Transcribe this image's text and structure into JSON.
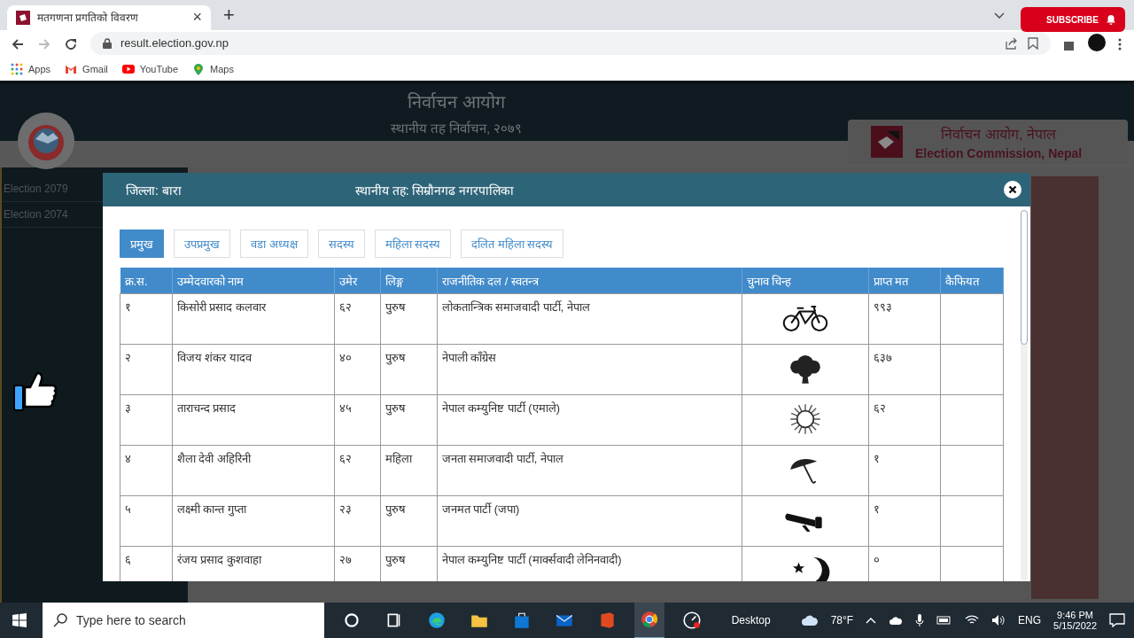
{
  "browser": {
    "tab_title": "मतगणना प्रगतिको विवरण",
    "tab_close": "×",
    "new_tab": "+",
    "url": "result.election.gov.np",
    "bookmarks": [
      {
        "label": "Apps",
        "kind": "apps"
      },
      {
        "label": "Gmail",
        "kind": "gmail"
      },
      {
        "label": "YouTube",
        "kind": "youtube"
      },
      {
        "label": "Maps",
        "kind": "maps"
      }
    ]
  },
  "subscribe": {
    "label": "SUBSCRIBE"
  },
  "site": {
    "title": "निर्वाचन आयोग",
    "subtitle": "स्थानीय तह निर्वाचन, २०७९",
    "brand_np": "निर्वाचन आयोग, नेपाल",
    "brand_en": "Election Commission, Nepal",
    "sidebar": [
      {
        "label": "Election 2079"
      },
      {
        "label": "Election 2074"
      }
    ]
  },
  "modal": {
    "district": "जिल्ला: बारा",
    "local_level": "स्थानीय तह: सिम्रौनगढ नगरपालिका",
    "tabs": [
      {
        "label": "प्रमुख",
        "selected": true
      },
      {
        "label": "उपप्रमुख",
        "selected": false
      },
      {
        "label": "वडा अध्यक्ष",
        "selected": false
      },
      {
        "label": "सदस्य",
        "selected": false
      },
      {
        "label": "महिला सदस्य",
        "selected": false
      },
      {
        "label": "दलित महिला सदस्य",
        "selected": false
      }
    ],
    "table": {
      "columns": [
        "क्र.स.",
        "उम्मेदवारको नाम",
        "उमेर",
        "लिङ्ग",
        "राजनीतिक दल / स्वतन्त्र",
        "चुनाव चिन्ह",
        "प्राप्त मत",
        "कैफियत"
      ],
      "rows": [
        {
          "sn": "१",
          "name": "किसोरी प्रसाद कलवार",
          "age": "६२",
          "gender": "पुरुष",
          "party": "लोकतान्त्रिक समाजवादी पार्टी, नेपाल",
          "kind": "bicycle",
          "votes": "९९३"
        },
        {
          "sn": "२",
          "name": "विजय शंकर यादव",
          "age": "४०",
          "gender": "पुरुष",
          "party": "नेपाली काँग्रेस",
          "kind": "tree",
          "votes": "६३७"
        },
        {
          "sn": "३",
          "name": "ताराचन्द प्रसाद",
          "age": "४५",
          "gender": "पुरुष",
          "party": "नेपाल कम्युनिष्ट पार्टी (एमाले)",
          "kind": "sun",
          "votes": "६२"
        },
        {
          "sn": "४",
          "name": "शैला देवी अहिरिनी",
          "age": "६२",
          "gender": "महिला",
          "party": "जनता समाजवादी पार्टी, नेपाल",
          "kind": "umbrella",
          "votes": "१"
        },
        {
          "sn": "५",
          "name": "लक्ष्मी कान्त गुप्ता",
          "age": "२३",
          "gender": "पुरुष",
          "party": "जनमत पार्टी (जपा)",
          "kind": "megaphone",
          "votes": "१"
        },
        {
          "sn": "६",
          "name": "रंजय प्रसाद कुशवाहा",
          "age": "२७",
          "gender": "पुरुष",
          "party": "नेपाल कम्युनिष्ट पार्टी (मार्क्सवादी लेनिनवादी)",
          "kind": "moon-star",
          "votes": "०"
        }
      ]
    }
  },
  "taskbar": {
    "search_placeholder": "Type here to search",
    "desktop": "Desktop",
    "weather": "78°F",
    "language": "ENG",
    "time": "9:46 PM",
    "date": "5/15/2022"
  }
}
